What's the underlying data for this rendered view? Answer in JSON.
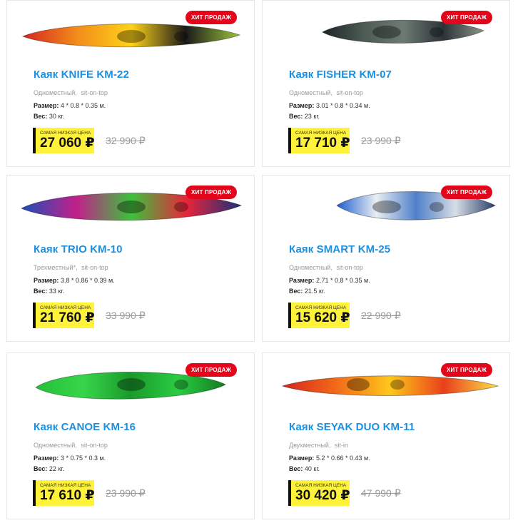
{
  "badge_label": "ХИТ ПРОДАЖ",
  "price_caption": "САМАЯ НИЗКАЯ ЦЕНА",
  "size_label": "Размер:",
  "weight_label": "Вес:",
  "products": [
    {
      "title": "Каяк KNIFE KM-22",
      "tags": [
        "Одноместный,",
        "sit-on-top"
      ],
      "size": "4 * 0.8 * 0.35 м.",
      "weight": "30 кг.",
      "price": "27 060 ₽",
      "old_price": "32 990 ₽",
      "colors": [
        "#d4261f",
        "#f28c1a",
        "#ffd21a",
        "#1a1a1a",
        "#9bc43a"
      ],
      "image": "kayak-knife"
    },
    {
      "title": "Каяк FISHER KM-07",
      "tags": [
        "Одноместный,",
        "sit-on-top"
      ],
      "size": "3.01 * 0.8 * 0.34 м.",
      "weight": "23 кг.",
      "price": "17 710 ₽",
      "old_price": "23 990 ₽",
      "colors": [
        "#1d2328",
        "#4b5a52",
        "#6e7b72",
        "#2c3338",
        "#8b9488"
      ],
      "image": "kayak-fisher"
    },
    {
      "title": "Каяк TRIO KM-10",
      "tags": [
        "Трехместный*,",
        "sit-on-top"
      ],
      "size": "3.8 * 0.86 * 0.39 м.",
      "weight": "33 кг.",
      "price": "21 760 ₽",
      "old_price": "33 990 ₽",
      "colors": [
        "#1d4fb8",
        "#c21f8a",
        "#3cc23c",
        "#e8243a",
        "#1a2f7a"
      ],
      "image": "kayak-trio"
    },
    {
      "title": "Каяк SMART KM-25",
      "tags": [
        "Одноместный,",
        "sit-on-top"
      ],
      "size": "2.71 * 0.8 * 0.35 м.",
      "weight": "21.5 кг.",
      "price": "15 620 ₽",
      "old_price": "22 990 ₽",
      "colors": [
        "#1f5fd1",
        "#eaeef2",
        "#4f7fc9",
        "#d6dde4",
        "#2a3f6a"
      ],
      "image": "kayak-smart"
    },
    {
      "title": "Каяк CANOE KM-16",
      "tags": [
        "Одноместный,",
        "sit-on-top"
      ],
      "size": "3 * 0.75 * 0.3 м.",
      "weight": "22 кг.",
      "price": "17 610 ₽",
      "old_price": "23 990 ₽",
      "colors": [
        "#23c03a",
        "#38d54a",
        "#1a9a2c",
        "#2bcc42",
        "#147a22"
      ],
      "image": "kayak-canoe"
    },
    {
      "title": "Каяк SEYAK DUO KM-11",
      "tags": [
        "Двухместный,",
        "sit-in"
      ],
      "size": "5.2 * 0.66 * 0.43 м.",
      "weight": "40 кг.",
      "price": "30 420 ₽",
      "old_price": "47 990 ₽",
      "colors": [
        "#d8261c",
        "#f26a1a",
        "#ffc71a",
        "#e8401a",
        "#ffe04a"
      ],
      "image": "kayak-seyak"
    }
  ]
}
